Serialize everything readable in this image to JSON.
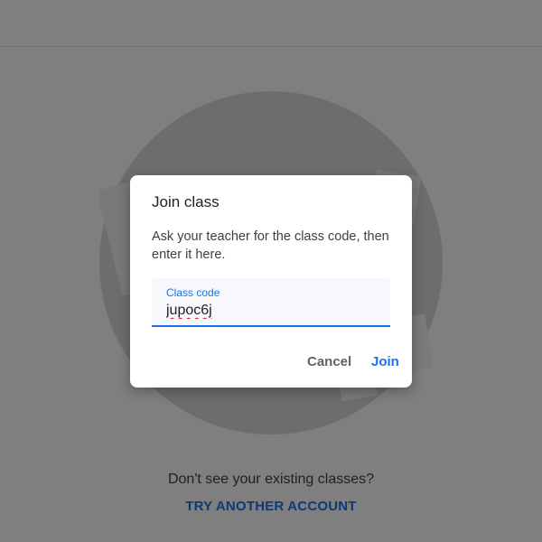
{
  "background": {
    "empty_state_question": "Don't see your existing classes?",
    "try_another_account": "TRY ANOTHER ACCOUNT"
  },
  "dialog": {
    "title": "Join class",
    "description": "Ask your teacher for the class code, then enter it here.",
    "field": {
      "label": "Class code",
      "value": "jupoc6j"
    },
    "buttons": {
      "cancel": "Cancel",
      "join": "Join"
    }
  },
  "colors": {
    "accent": "#1a73e8",
    "scrim": "rgba(0,0,0,0.5)",
    "dialog_bg": "#ffffff"
  }
}
